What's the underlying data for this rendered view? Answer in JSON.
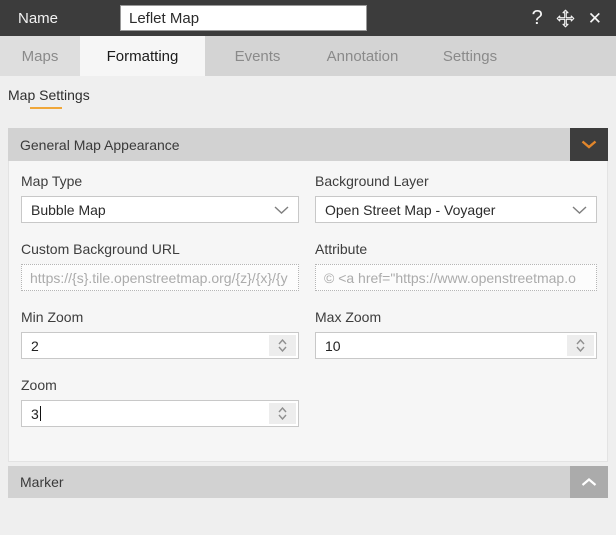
{
  "titlebar": {
    "name_label": "Name",
    "name_value": "Leflet Map",
    "help_icon": "?",
    "close_icon": "✕"
  },
  "tabs": [
    {
      "label": "Maps"
    },
    {
      "label": "Formatting"
    },
    {
      "label": "Events"
    },
    {
      "label": "Annotation"
    },
    {
      "label": "Settings"
    }
  ],
  "active_tab": "Formatting",
  "subtabs": {
    "map_settings": "Map Settings"
  },
  "sections": {
    "general": {
      "title": "General Map Appearance",
      "state": "expanded"
    },
    "marker": {
      "title": "Marker",
      "state": "collapsed"
    }
  },
  "form": {
    "map_type": {
      "label": "Map Type",
      "value": "Bubble Map"
    },
    "background_layer": {
      "label": "Background Layer",
      "value": "Open Street Map - Voyager"
    },
    "custom_background_url": {
      "label": "Custom Background URL",
      "placeholder": "https://{s}.tile.openstreetmap.org/{z}/{x}/{y"
    },
    "attribute": {
      "label": "Attribute",
      "placeholder": "© <a href=\"https://www.openstreetmap.o"
    },
    "min_zoom": {
      "label": "Min Zoom",
      "value": "2"
    },
    "max_zoom": {
      "label": "Max Zoom",
      "value": "10"
    },
    "zoom": {
      "label": "Zoom",
      "value": "3"
    }
  },
  "colors": {
    "titlebar_bg": "#3c3c3c",
    "accent_orange": "#e2862b",
    "subtab_underline": "#f0a73a",
    "accordion_header_bg": "#d2d2d2",
    "marker_toggle_bg": "#ababab"
  }
}
